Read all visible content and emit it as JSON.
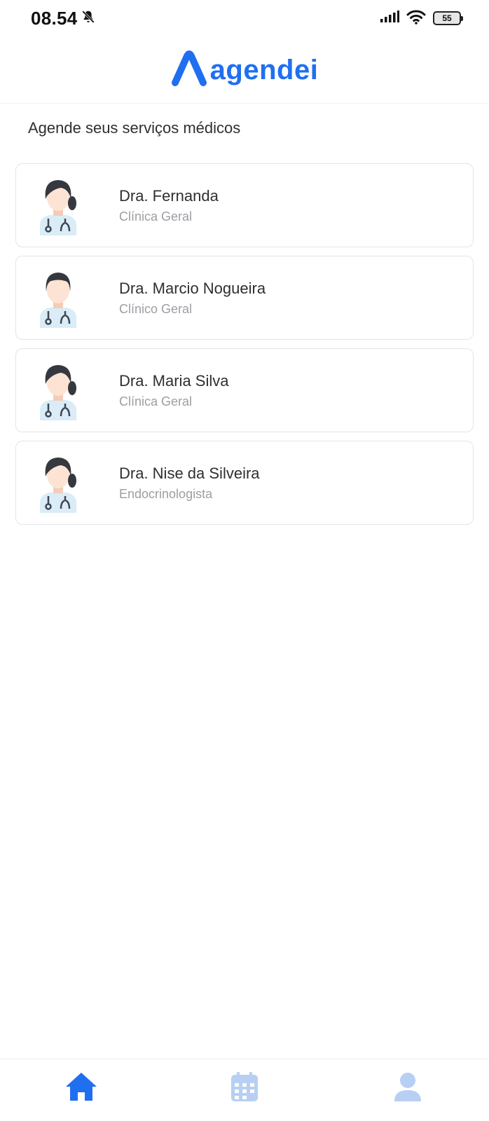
{
  "status_bar": {
    "time": "08.54",
    "battery": "55"
  },
  "header": {
    "logo_text": "agendei",
    "brand_color": "#1f6ff0"
  },
  "main": {
    "subtitle": "Agende seus serviços médicos",
    "doctors": [
      {
        "name": "Dra. Fernanda",
        "specialty": "Clínica Geral",
        "avatar": "female-doctor-icon"
      },
      {
        "name": "Dra. Marcio Nogueira",
        "specialty": "Clínico Geral",
        "avatar": "male-doctor-icon"
      },
      {
        "name": "Dra. Maria Silva",
        "specialty": "Clínica Geral",
        "avatar": "female-doctor-icon"
      },
      {
        "name": "Dra. Nise da Silveira",
        "specialty": "Endocrinologista",
        "avatar": "female-doctor-icon"
      }
    ]
  },
  "bottom_nav": {
    "items": [
      {
        "icon": "home-icon",
        "active": true
      },
      {
        "icon": "calendar-icon",
        "active": false
      },
      {
        "icon": "profile-icon",
        "active": false
      }
    ],
    "active_color": "#1f6ff0",
    "inactive_color": "#b7cff3"
  }
}
